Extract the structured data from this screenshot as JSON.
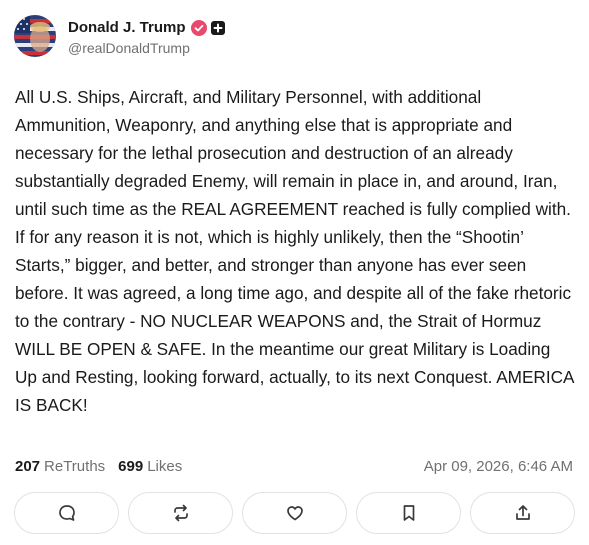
{
  "author": {
    "display_name": "Donald J. Trump",
    "handle": "@realDonaldTrump",
    "avatar_icon": "avatar-flag-portrait",
    "verified_color": "#e74a6a"
  },
  "post": {
    "text": "All U.S. Ships, Aircraft, and Military Personnel, with additional Ammunition, Weaponry, and anything else that is appropriate and necessary for the lethal prosecution and destruction of an already substantially degraded Enemy, will remain in place in, and around, Iran, until such time as the REAL AGREEMENT reached is fully complied with. If for any reason it is not, which is highly unlikely, then the “Shootin’ Starts,” bigger, and better, and stronger than anyone has ever seen before. It was agreed, a long time ago, and despite all of the fake rhetoric to the contrary - NO NUCLEAR WEAPONS and, the Strait of Hormuz WILL BE OPEN & SAFE. In the meantime our great Military is Loading Up and Resting, looking forward, actually, to its next Conquest. AMERICA IS BACK!"
  },
  "stats": {
    "retruths_count": "207",
    "retruths_label": "ReTruths",
    "likes_count": "699",
    "likes_label": "Likes",
    "timestamp": "Apr 09, 2026, 6:46 AM"
  },
  "actions": [
    {
      "icon": "reply-icon"
    },
    {
      "icon": "retruth-icon"
    },
    {
      "icon": "like-icon"
    },
    {
      "icon": "bookmark-icon"
    },
    {
      "icon": "share-icon"
    }
  ]
}
